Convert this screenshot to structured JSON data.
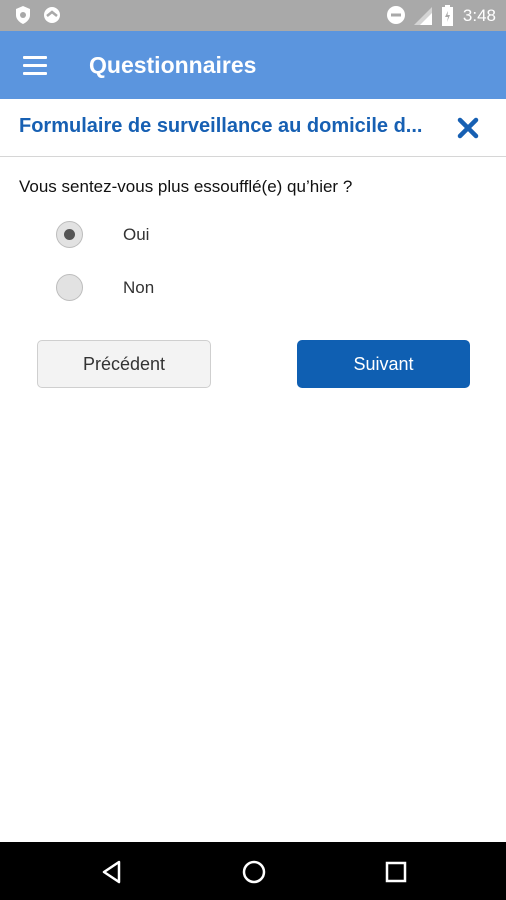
{
  "status_bar": {
    "time": "3:48"
  },
  "app_bar": {
    "title": "Questionnaires"
  },
  "form": {
    "title": "Formulaire de surveillance au domicile d..."
  },
  "question": {
    "text": "Vous sentez-vous plus essoufflé(e) qu’hier ?",
    "options": [
      {
        "label": "Oui",
        "selected": true
      },
      {
        "label": "Non",
        "selected": false
      }
    ]
  },
  "buttons": {
    "previous": "Précédent",
    "next": "Suivant"
  },
  "colors": {
    "app_bar": "#5b95de",
    "accent": "#1760b3",
    "primary_button": "#0f5fb2"
  }
}
